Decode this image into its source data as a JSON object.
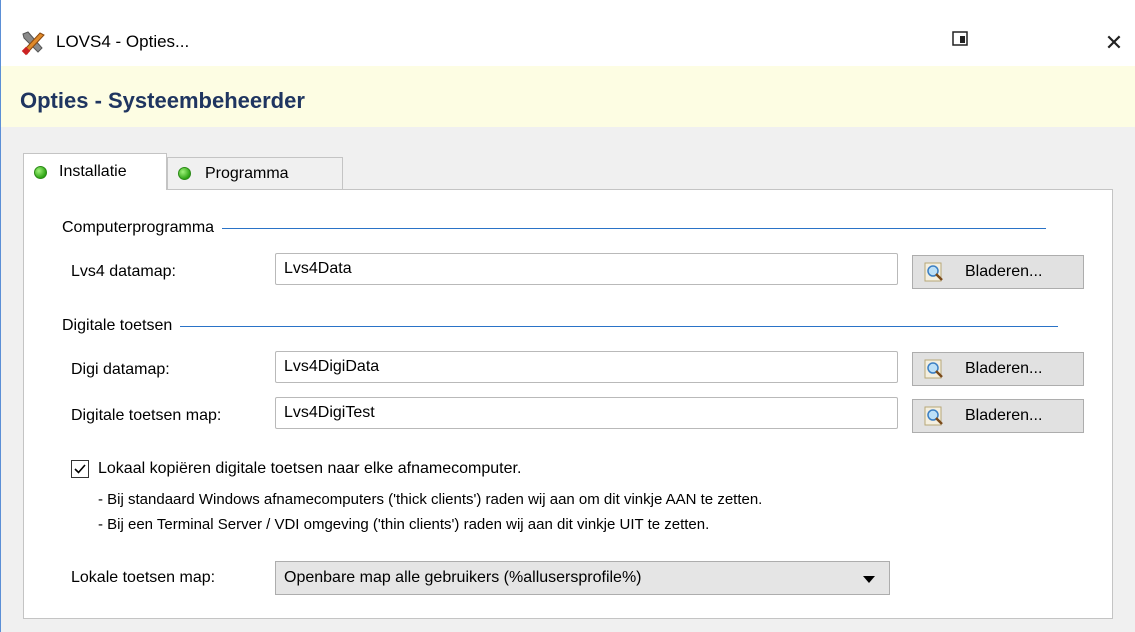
{
  "window": {
    "title": "LOVS4 - Opties...",
    "close_glyph": "✕",
    "app_icon": "tools-icon",
    "snap_icon": "snap-layout-icon"
  },
  "header": {
    "title": "Opties - Systeembeheerder",
    "background": "#fdfde3",
    "title_color": "#1f3560"
  },
  "tabs": [
    {
      "label": "Installatie",
      "selected": true,
      "status": "green"
    },
    {
      "label": "Programma",
      "selected": false,
      "status": "green"
    }
  ],
  "sections": {
    "computerprogramma": "Computerprogramma",
    "digitale_toetsen": "Digitale toetsen"
  },
  "fields": {
    "lvs4_datamap": {
      "label": "Lvs4 datamap:",
      "value": "Lvs4Data"
    },
    "digi_datamap": {
      "label": "Digi datamap:",
      "value": "Lvs4DigiData"
    },
    "digitale_toetsen_map": {
      "label": "Digitale toetsen map:",
      "value": "Lvs4DigiTest"
    }
  },
  "browse_label": "Bladeren...",
  "checkbox": {
    "checked": true,
    "label": "Lokaal kopiëren digitale toetsen naar elke afnamecomputer.",
    "note1": "- Bij standaard Windows afnamecomputers ('thick clients') raden wij  aan om dit vinkje AAN te zetten.",
    "note2": "- Bij een Terminal Server / VDI omgeving ('thin clients') raden wij aan dit vinkje UIT te zetten."
  },
  "lokale_map": {
    "label": "Lokale toetsen map:",
    "value": "Openbare map alle gebruikers (%allusersprofile%)"
  },
  "colors": {
    "accent_line": "#2a73c7",
    "status_green": "#2fa515"
  }
}
